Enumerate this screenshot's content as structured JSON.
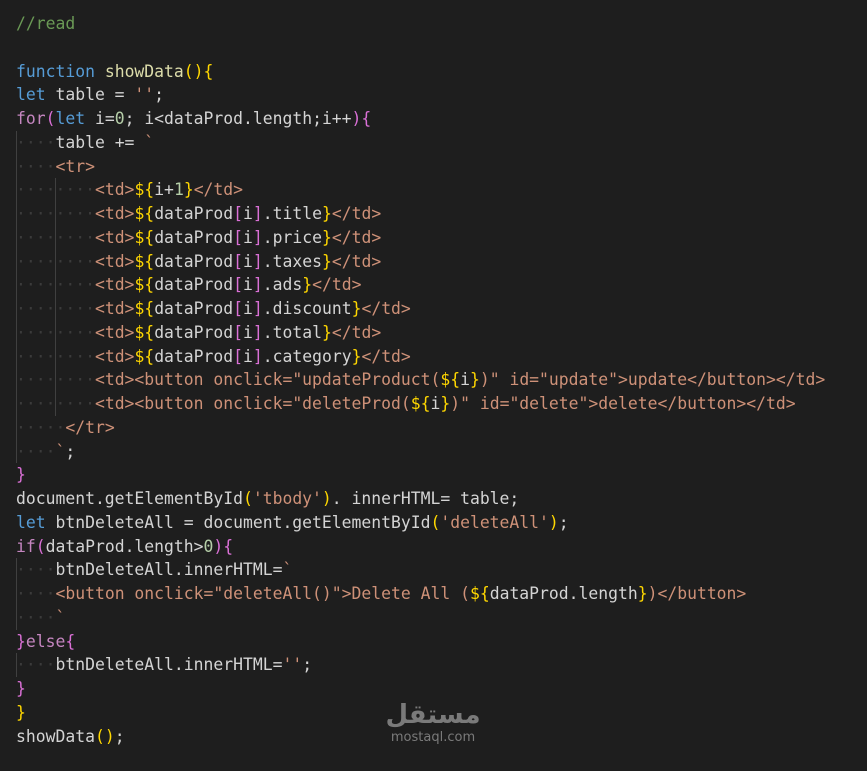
{
  "editor": {
    "theme_colors": {
      "background": "#1e1e1e",
      "comment": "#6a9955",
      "keyword": "#569cd6",
      "control": "#c586c0",
      "function": "#dcdcaa",
      "string": "#ce9178",
      "number": "#b5cea8",
      "attribute": "#9cdcfe",
      "bracket_yellow": "#ffd700",
      "bracket_pink": "#da70d6",
      "bracket_blue": "#179fff"
    },
    "lines": [
      [
        [
          "comment",
          "//read"
        ]
      ],
      [],
      [
        [
          "keyword",
          "function"
        ],
        [
          "plain",
          " "
        ],
        [
          "func",
          "showData"
        ],
        [
          "b1",
          "()"
        ],
        [
          "b1",
          "{"
        ]
      ],
      [
        [
          "keyword",
          "let"
        ],
        [
          "plain",
          " table = "
        ],
        [
          "str",
          "''"
        ],
        [
          "plain",
          ";"
        ]
      ],
      [
        [
          "control",
          "for"
        ],
        [
          "b2",
          "("
        ],
        [
          "keyword",
          "let"
        ],
        [
          "plain",
          " i="
        ],
        [
          "num",
          "0"
        ],
        [
          "plain",
          "; i<dataProd.length;i++"
        ],
        [
          "b2",
          ")"
        ],
        [
          "b2",
          "{"
        ]
      ],
      [
        [
          "ws",
          "····"
        ],
        [
          "plain",
          "table += "
        ],
        [
          "str",
          "`"
        ]
      ],
      [
        [
          "ws",
          "····"
        ],
        [
          "str",
          "<tr>"
        ]
      ],
      [
        [
          "ws",
          "········"
        ],
        [
          "str",
          "<td>"
        ],
        [
          "b1",
          "${"
        ],
        [
          "plain",
          "i+"
        ],
        [
          "num",
          "1"
        ],
        [
          "b1",
          "}"
        ],
        [
          "str",
          "</td>"
        ]
      ],
      [
        [
          "ws",
          "········"
        ],
        [
          "str",
          "<td>"
        ],
        [
          "b1",
          "${"
        ],
        [
          "plain",
          "dataProd"
        ],
        [
          "b2",
          "["
        ],
        [
          "plain",
          "i"
        ],
        [
          "b2",
          "]"
        ],
        [
          "plain",
          ".title"
        ],
        [
          "b1",
          "}"
        ],
        [
          "str",
          "</td>"
        ]
      ],
      [
        [
          "ws",
          "········"
        ],
        [
          "str",
          "<td>"
        ],
        [
          "b1",
          "${"
        ],
        [
          "plain",
          "dataProd"
        ],
        [
          "b2",
          "["
        ],
        [
          "plain",
          "i"
        ],
        [
          "b2",
          "]"
        ],
        [
          "plain",
          ".price"
        ],
        [
          "b1",
          "}"
        ],
        [
          "str",
          "</td>"
        ]
      ],
      [
        [
          "ws",
          "········"
        ],
        [
          "str",
          "<td>"
        ],
        [
          "b1",
          "${"
        ],
        [
          "plain",
          "dataProd"
        ],
        [
          "b2",
          "["
        ],
        [
          "plain",
          "i"
        ],
        [
          "b2",
          "]"
        ],
        [
          "plain",
          ".taxes"
        ],
        [
          "b1",
          "}"
        ],
        [
          "str",
          "</td>"
        ]
      ],
      [
        [
          "ws",
          "········"
        ],
        [
          "str",
          "<td>"
        ],
        [
          "b1",
          "${"
        ],
        [
          "plain",
          "dataProd"
        ],
        [
          "b2",
          "["
        ],
        [
          "plain",
          "i"
        ],
        [
          "b2",
          "]"
        ],
        [
          "plain",
          ".ads"
        ],
        [
          "b1",
          "}"
        ],
        [
          "str",
          "</td>"
        ]
      ],
      [
        [
          "ws",
          "········"
        ],
        [
          "str",
          "<td>"
        ],
        [
          "b1",
          "${"
        ],
        [
          "plain",
          "dataProd"
        ],
        [
          "b2",
          "["
        ],
        [
          "plain",
          "i"
        ],
        [
          "b2",
          "]"
        ],
        [
          "plain",
          ".discount"
        ],
        [
          "b1",
          "}"
        ],
        [
          "str",
          "</td>"
        ]
      ],
      [
        [
          "ws",
          "········"
        ],
        [
          "str",
          "<td>"
        ],
        [
          "b1",
          "${"
        ],
        [
          "plain",
          "dataProd"
        ],
        [
          "b2",
          "["
        ],
        [
          "plain",
          "i"
        ],
        [
          "b2",
          "]"
        ],
        [
          "plain",
          ".total"
        ],
        [
          "b1",
          "}"
        ],
        [
          "str",
          "</td>"
        ]
      ],
      [
        [
          "ws",
          "········"
        ],
        [
          "str",
          "<td>"
        ],
        [
          "b1",
          "${"
        ],
        [
          "plain",
          "dataProd"
        ],
        [
          "b2",
          "["
        ],
        [
          "plain",
          "i"
        ],
        [
          "b2",
          "]"
        ],
        [
          "plain",
          ".category"
        ],
        [
          "b1",
          "}"
        ],
        [
          "str",
          "</td>"
        ]
      ],
      [
        [
          "ws",
          "········"
        ],
        [
          "str",
          "<td><button onclick=\"updateProduct("
        ],
        [
          "b1",
          "${"
        ],
        [
          "plain",
          "i"
        ],
        [
          "b1",
          "}"
        ],
        [
          "str",
          ")\" id=\"update\">update</button></td>"
        ]
      ],
      [
        [
          "ws",
          "········"
        ],
        [
          "str",
          "<td><button onclick=\"deleteProd("
        ],
        [
          "b1",
          "${"
        ],
        [
          "plain",
          "i"
        ],
        [
          "b1",
          "}"
        ],
        [
          "str",
          ")\" id=\"delete\">delete</button></td>"
        ]
      ],
      [
        [
          "ws",
          "·····"
        ],
        [
          "str",
          "</tr>"
        ]
      ],
      [
        [
          "ws",
          "····"
        ],
        [
          "str",
          "`"
        ],
        [
          "plain",
          ";"
        ]
      ],
      [
        [
          "b2",
          "}"
        ]
      ],
      [
        [
          "plain",
          "document.getElementById"
        ],
        [
          "b1",
          "("
        ],
        [
          "str",
          "'tbody'"
        ],
        [
          "b1",
          ")"
        ],
        [
          "plain",
          ". innerHTML= table;"
        ]
      ],
      [
        [
          "keyword",
          "let"
        ],
        [
          "plain",
          " btnDeleteAll = document.getElementById"
        ],
        [
          "b1",
          "("
        ],
        [
          "str",
          "'deleteAll'"
        ],
        [
          "b1",
          ")"
        ],
        [
          "plain",
          ";"
        ]
      ],
      [
        [
          "control",
          "if"
        ],
        [
          "b2",
          "("
        ],
        [
          "plain",
          "dataProd.length>"
        ],
        [
          "num",
          "0"
        ],
        [
          "b2",
          ")"
        ],
        [
          "b2",
          "{"
        ]
      ],
      [
        [
          "ws",
          "····"
        ],
        [
          "plain",
          "btnDeleteAll.innerHTML="
        ],
        [
          "str",
          "`"
        ]
      ],
      [
        [
          "ws",
          "····"
        ],
        [
          "str",
          "<button onclick=\"deleteAll()\">Delete All ("
        ],
        [
          "b1",
          "${"
        ],
        [
          "plain",
          "dataProd.length"
        ],
        [
          "b1",
          "}"
        ],
        [
          "str",
          ")</button>"
        ]
      ],
      [
        [
          "ws",
          "····"
        ],
        [
          "str",
          "`"
        ]
      ],
      [
        [
          "b2",
          "}"
        ],
        [
          "control",
          "else"
        ],
        [
          "b2",
          "{"
        ]
      ],
      [
        [
          "ws",
          "····"
        ],
        [
          "plain",
          "btnDeleteAll.innerHTML="
        ],
        [
          "str",
          "''"
        ],
        [
          "plain",
          ";"
        ]
      ],
      [
        [
          "b2",
          "}"
        ]
      ],
      [
        [
          "b1",
          "}"
        ]
      ],
      [
        [
          "plain",
          "showData"
        ],
        [
          "b1",
          "()"
        ],
        [
          "plain",
          ";"
        ]
      ]
    ]
  },
  "watermark": {
    "arabic": "مستقل",
    "latin": "mostaql.com"
  }
}
